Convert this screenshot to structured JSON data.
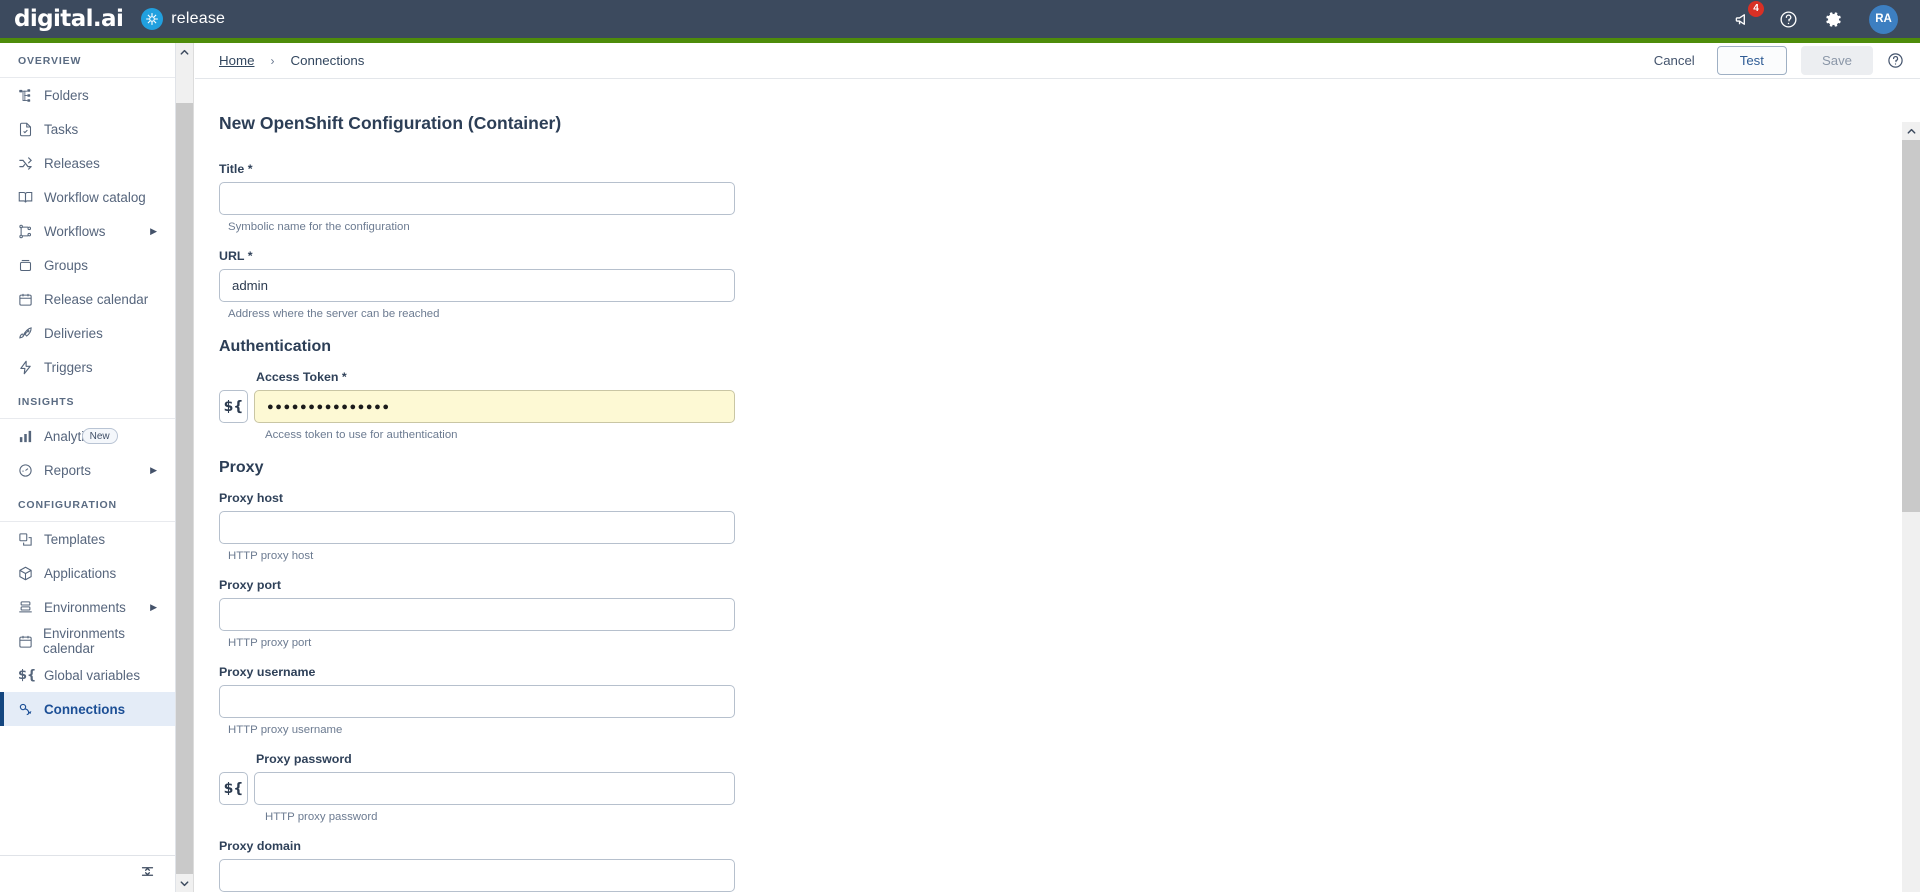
{
  "topbar": {
    "brand_name": "digital.ai",
    "product_name": "release",
    "notification_count": "4",
    "avatar_initials": "RA",
    "icons": [
      "megaphone-icon",
      "help-icon",
      "settings-gear-icon"
    ]
  },
  "sidebar": {
    "sections": [
      {
        "label": "OVERVIEW",
        "items": [
          {
            "label": "Folders",
            "icon": "folders-icon",
            "arrow": false,
            "active": false
          },
          {
            "label": "Tasks",
            "icon": "tasks-icon",
            "arrow": false,
            "active": false
          },
          {
            "label": "Releases",
            "icon": "releases-icon",
            "arrow": false,
            "active": false
          },
          {
            "label": "Workflow catalog",
            "icon": "book-icon",
            "arrow": false,
            "active": false
          },
          {
            "label": "Workflows",
            "icon": "workflows-icon",
            "arrow": true,
            "active": false
          },
          {
            "label": "Groups",
            "icon": "groups-icon",
            "arrow": false,
            "active": false
          },
          {
            "label": "Release calendar",
            "icon": "calendar-icon",
            "arrow": false,
            "active": false
          },
          {
            "label": "Deliveries",
            "icon": "rocket-icon",
            "arrow": false,
            "active": false
          },
          {
            "label": "Triggers",
            "icon": "lightning-icon",
            "arrow": false,
            "active": false
          }
        ]
      },
      {
        "label": "INSIGHTS",
        "items": [
          {
            "label": "Analytics",
            "icon": "bar-chart-icon",
            "arrow": false,
            "active": false,
            "badge": "New"
          },
          {
            "label": "Reports",
            "icon": "gauge-icon",
            "arrow": true,
            "active": false
          }
        ]
      },
      {
        "label": "CONFIGURATION",
        "items": [
          {
            "label": "Templates",
            "icon": "templates-icon",
            "arrow": false,
            "active": false
          },
          {
            "label": "Applications",
            "icon": "cube-icon",
            "arrow": false,
            "active": false
          },
          {
            "label": "Environments",
            "icon": "environments-icon",
            "arrow": true,
            "active": false
          },
          {
            "label": "Environments calendar",
            "icon": "calendar-icon",
            "arrow": false,
            "active": false
          },
          {
            "label": "Global variables",
            "icon": "variable-icon",
            "arrow": false,
            "active": false
          },
          {
            "label": "Connections",
            "icon": "connections-icon",
            "arrow": false,
            "active": true
          }
        ]
      }
    ],
    "collapse_icon": "collapse-icon"
  },
  "toolbar": {
    "breadcrumb_home": "Home",
    "breadcrumb_separator": "›",
    "breadcrumb_current": "Connections",
    "cancel_label": "Cancel",
    "test_label": "Test",
    "save_label": "Save",
    "help_icon": "help-circle-icon"
  },
  "form": {
    "title": "New OpenShift Configuration (Container)",
    "fields": [
      {
        "label": "Title",
        "required": true,
        "value": "",
        "hint": "Symbolic name for the configuration",
        "variable_button": null,
        "autofill": false
      },
      {
        "label": "URL",
        "required": true,
        "value": "admin",
        "hint": "Address where the server can be reached",
        "variable_button": null,
        "autofill": false
      }
    ],
    "auth_section": {
      "heading": "Authentication",
      "field": {
        "label": "Access Token",
        "required": true,
        "value": "●●●●●●●●●●●●●●●",
        "hint": "Access token to use for authentication",
        "variable_button": "${",
        "autofill": true
      }
    },
    "proxy_section": {
      "heading": "Proxy",
      "fields": [
        {
          "label": "Proxy host",
          "required": false,
          "value": "",
          "hint": "HTTP proxy host",
          "variable_button": null,
          "autofill": false
        },
        {
          "label": "Proxy port",
          "required": false,
          "value": "",
          "hint": "HTTP proxy port",
          "variable_button": null,
          "autofill": false
        },
        {
          "label": "Proxy username",
          "required": false,
          "value": "",
          "hint": "HTTP proxy username",
          "variable_button": null,
          "autofill": false
        },
        {
          "label": "Proxy password",
          "required": false,
          "value": "",
          "hint": "HTTP proxy password",
          "variable_button": "${",
          "autofill": false
        },
        {
          "label": "Proxy domain",
          "required": false,
          "value": "",
          "hint": "",
          "variable_button": null,
          "autofill": false
        }
      ]
    }
  },
  "colors": {
    "topbar": "#3c4a5e",
    "accent_green": "#4e8c0b",
    "brand_blue": "#21a0df",
    "active_item_bg": "#e4ecf7",
    "active_item_text": "#1c4f96",
    "autofill_bg": "#fdf9d4",
    "badge_red": "#d93025"
  }
}
